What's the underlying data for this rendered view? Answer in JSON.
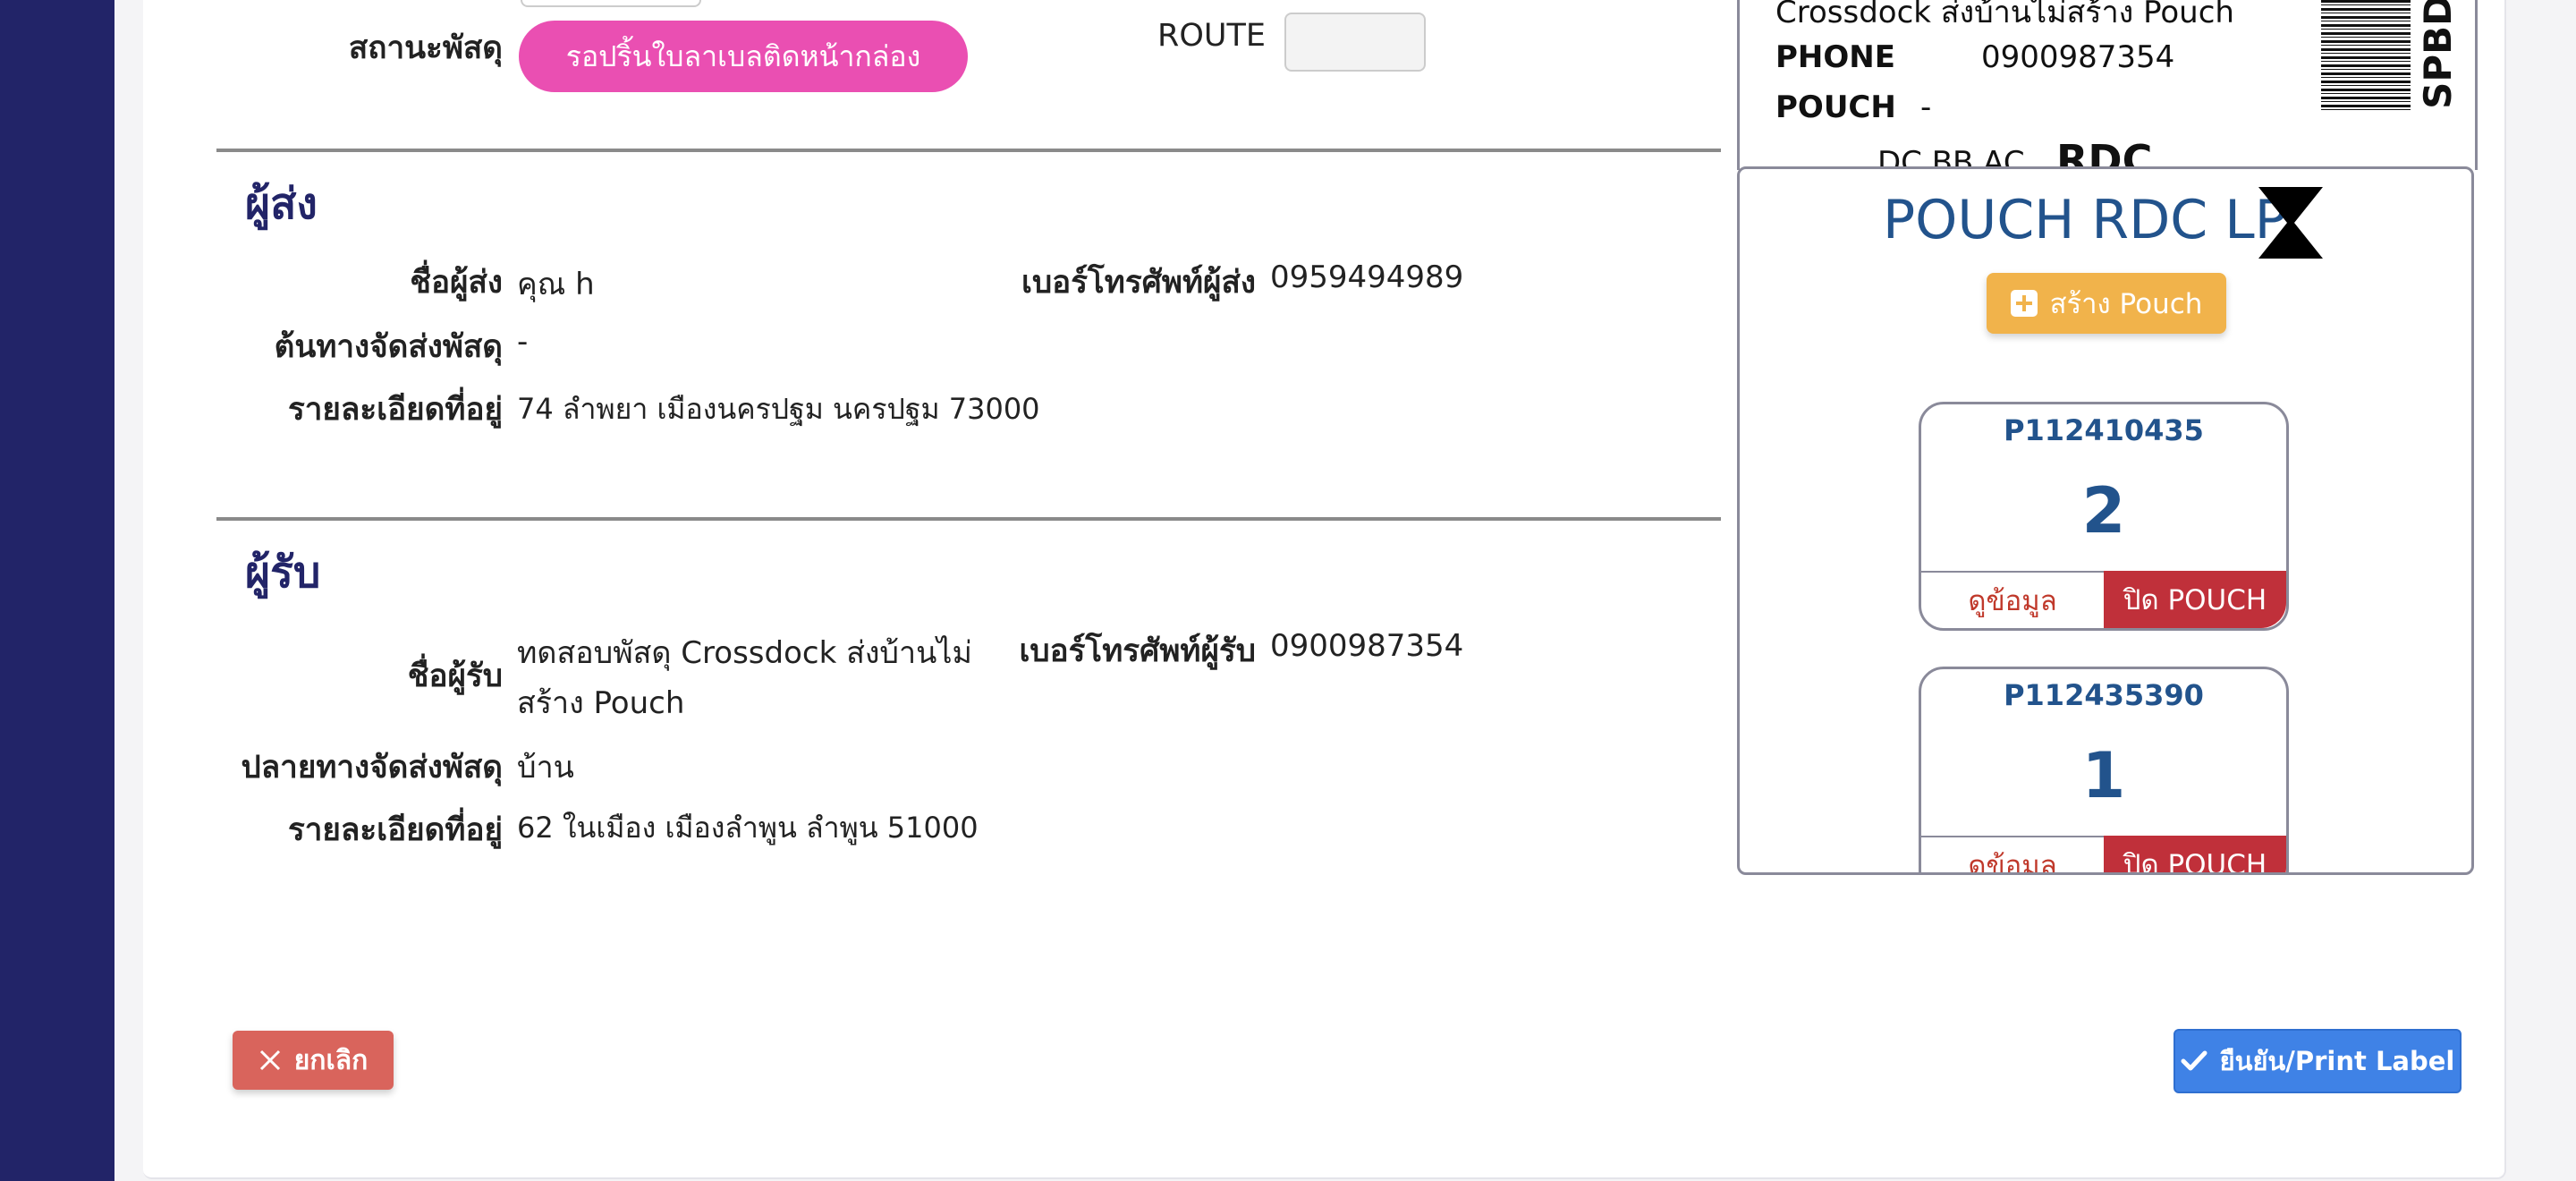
{
  "status": {
    "label": "สถานะพัสดุ",
    "value": "รอปริ้นใบลาเบลติดหน้ากล่อง",
    "route_label": "ROUTE",
    "route_value": ""
  },
  "sender": {
    "section_title": "ผู้ส่ง",
    "name_label": "ชื่อผู้ส่ง",
    "name": "คุณ h",
    "phone_label": "เบอร์โทรศัพท์ผู้ส่ง",
    "phone": "0959494989",
    "origin_label": "ต้นทางจัดส่งพัสดุ",
    "origin": "-",
    "address_label": "รายละเอียดที่อยู่",
    "address": "74 ลำพยา เมืองนครปฐม นครปฐม 73000"
  },
  "receiver": {
    "section_title": "ผู้รับ",
    "name_label": "ชื่อผู้รับ",
    "name_line1": "ทดสอบพัสดุ Crossdock ส่งบ้านไม่",
    "name_line2": "สร้าง Pouch",
    "phone_label": "เบอร์โทรศัพท์ผู้รับ",
    "phone": "0900987354",
    "destination_label": "ปลายทางจัดส่งพัสดุ",
    "destination": "บ้าน",
    "address_label": "รายละเอียดที่อยู่",
    "address": "62 ในเมือง เมืองลำพูน ลำพูน 51000"
  },
  "label_preview": {
    "line1": "Crossdock ส่งบ้านไม่สร้าง Pouch",
    "phone_label": "PHONE",
    "phone": "0900987354",
    "pouch_label": "POUCH",
    "pouch": "-",
    "codes": "DC BB AC",
    "rdc": "RDC",
    "side_code": "SPBD"
  },
  "pouch_panel": {
    "title": "POUCH RDC LP",
    "create_button": "สร้าง Pouch",
    "pouches": [
      {
        "id": "P112410435",
        "count": "2",
        "view_label": "ดูข้อมูล",
        "close_label": "ปิด POUCH"
      },
      {
        "id": "P112435390",
        "count": "1",
        "view_label": "ดูข้อมูล",
        "close_label": "ปิด POUCH"
      }
    ]
  },
  "footer": {
    "cancel_label": "ยกเลิก",
    "confirm_label": "ยืนยัน/Print Label"
  },
  "colors": {
    "sidebar": "#222468",
    "status_pill": "#ea4fb2",
    "pouch_title": "#22538c",
    "create_button": "#f1b34b",
    "close_pouch": "#c0303a",
    "cancel": "#d9645c",
    "confirm": "#3f82e6"
  },
  "icons": {
    "hourglass": "hourglass-icon",
    "plus": "plus-square-icon",
    "cancel": "close-icon",
    "confirm": "check-icon"
  }
}
